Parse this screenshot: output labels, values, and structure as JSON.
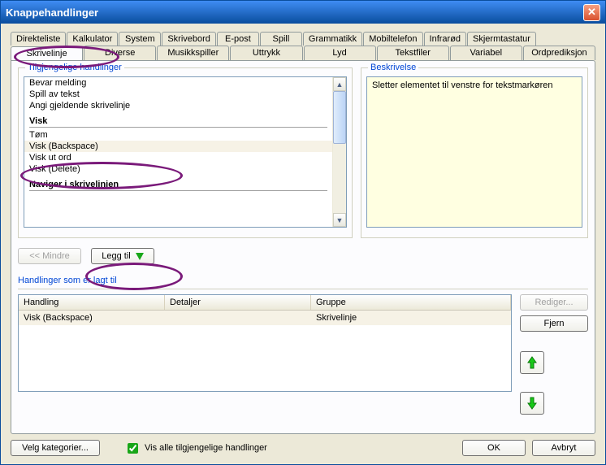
{
  "window": {
    "title": "Knappehandlinger"
  },
  "tabs_row1": [
    "Direkteliste",
    "Kalkulator",
    "System",
    "Skrivebord",
    "E-post",
    "Spill",
    "Grammatikk",
    "Mobiltelefon",
    "Infrarød",
    "Skjermtastatur"
  ],
  "tabs_row2": [
    "Skrivelinje",
    "Diverse",
    "Musikkspiller",
    "Uttrykk",
    "Lyd",
    "Tekstfiler",
    "Variabel",
    "Ordprediksjon"
  ],
  "active_tab": "Skrivelinje",
  "available": {
    "legend": "Tilgjengelige handlinger",
    "items": [
      {
        "t": "item",
        "label": "Bevar melding"
      },
      {
        "t": "item",
        "label": "Spill av tekst"
      },
      {
        "t": "item",
        "label": "Angi gjeldende skrivelinje"
      },
      {
        "t": "group",
        "label": "Visk"
      },
      {
        "t": "item",
        "label": "Tøm"
      },
      {
        "t": "item",
        "label": "Visk (Backspace)",
        "selected": true
      },
      {
        "t": "item",
        "label": "Visk ut ord"
      },
      {
        "t": "item",
        "label": "Visk (Delete)"
      },
      {
        "t": "group",
        "label": "Naviger i skrivelinjen"
      }
    ]
  },
  "description": {
    "legend": "Beskrivelse",
    "text": "Sletter elementet til venstre for tekstmarkøren"
  },
  "buttons": {
    "less": "<< Mindre",
    "add": "Legg til",
    "edit": "Rediger...",
    "remove": "Fjern",
    "categories": "Velg kategorier...",
    "ok": "OK",
    "cancel": "Avbryt"
  },
  "added": {
    "title": "Handlinger som er lagt til",
    "headers": {
      "action": "Handling",
      "details": "Detaljer",
      "group": "Gruppe"
    },
    "rows": [
      {
        "action": "Visk (Backspace)",
        "details": "",
        "group": "Skrivelinje"
      }
    ]
  },
  "show_all": {
    "label": "Vis alle tilgjengelige handlinger",
    "checked": true
  }
}
